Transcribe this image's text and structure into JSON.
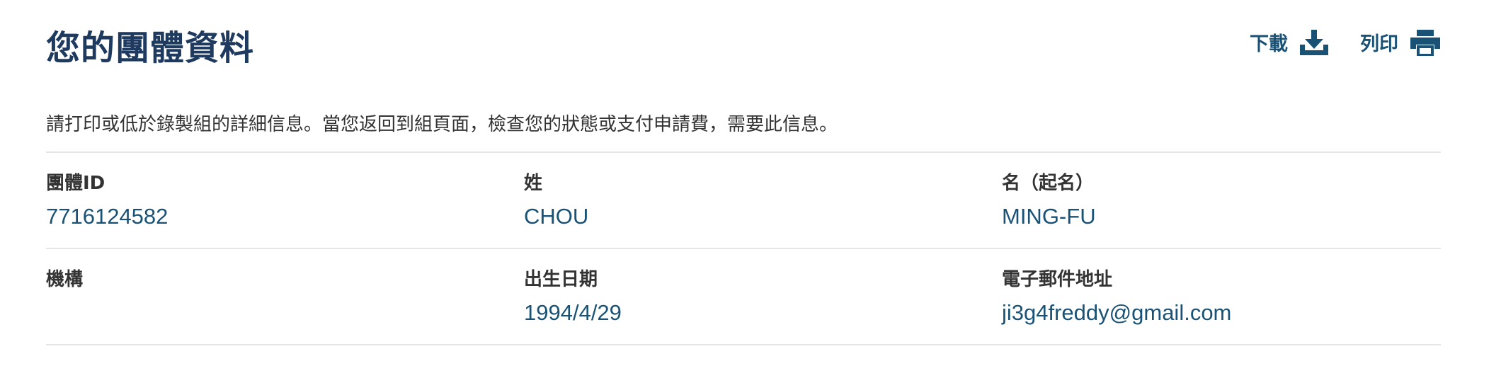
{
  "header": {
    "title": "您的團體資料",
    "download_label": "下載",
    "print_label": "列印"
  },
  "intro_text": "請打印或低於錄製組的詳細信息。當您返回到組頁面，檢查您的狀態或支付申請費，需要此信息。",
  "rows": [
    [
      {
        "label": "團體ID",
        "value": "7716124582"
      },
      {
        "label": "姓",
        "value": "CHOU"
      },
      {
        "label": "名（起名）",
        "value": "MING-FU"
      }
    ],
    [
      {
        "label": "機構",
        "value": ""
      },
      {
        "label": "出生日期",
        "value": "1994/4/29"
      },
      {
        "label": "電子郵件地址",
        "value": "ji3g4freddy@gmail.com"
      }
    ]
  ],
  "colors": {
    "title": "#1e3a5f",
    "accent": "#1a5276",
    "text": "#333333",
    "divider": "#e6e6e6"
  },
  "icons": {
    "download": "download-tray-icon",
    "print": "printer-icon"
  }
}
